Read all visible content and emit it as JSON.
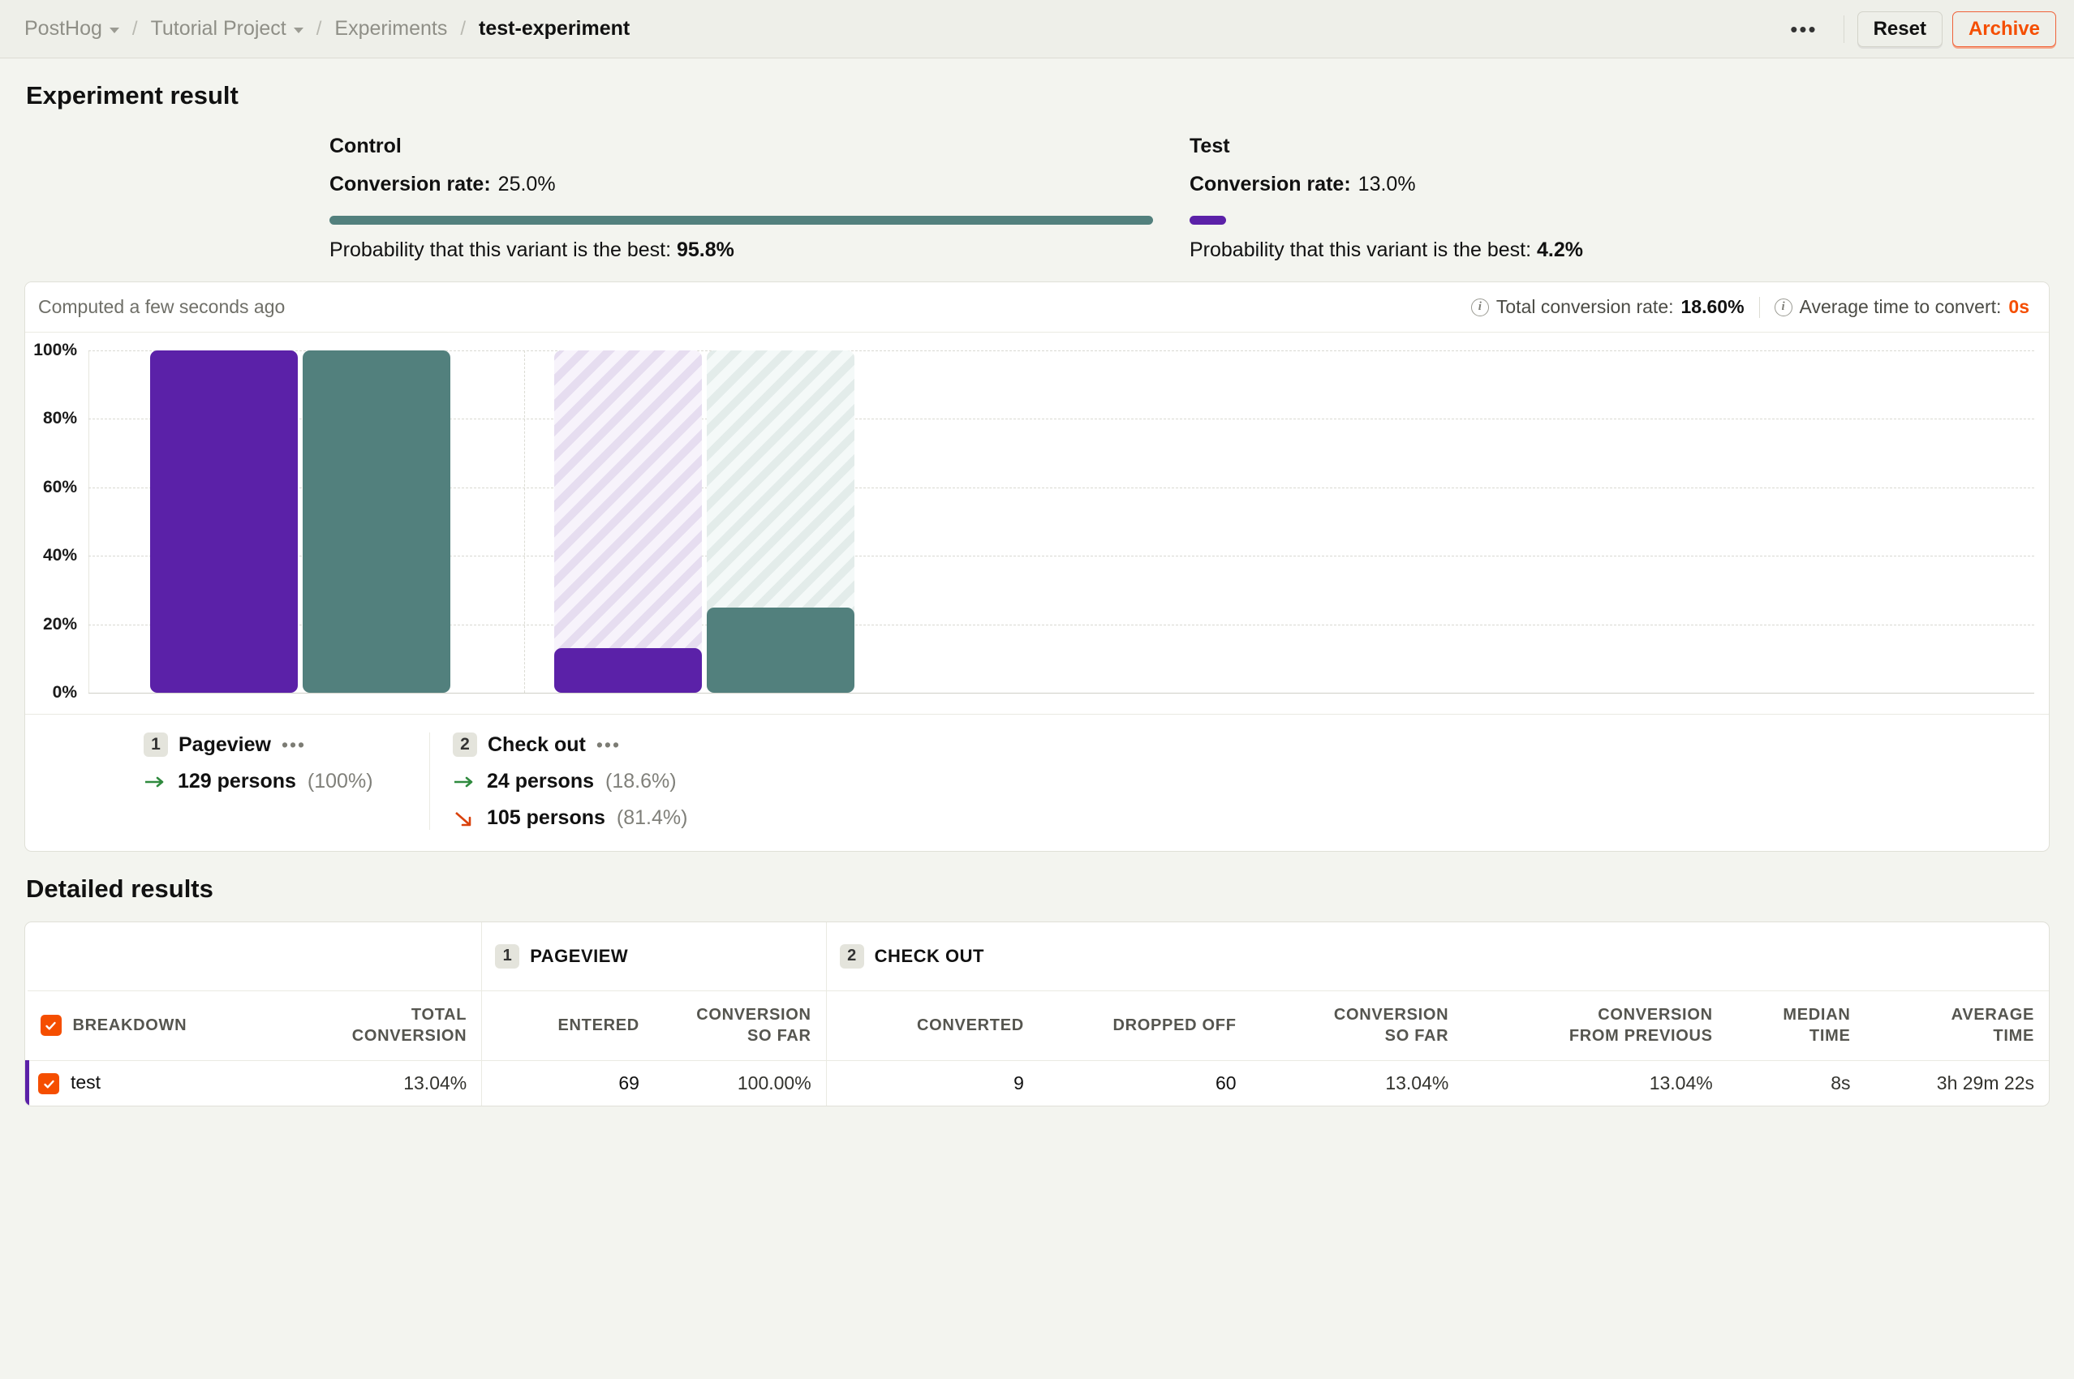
{
  "breadcrumbs": [
    {
      "label": "PostHog",
      "has_chevron": true,
      "active": false
    },
    {
      "label": "Tutorial Project",
      "has_chevron": true,
      "active": false
    },
    {
      "label": "Experiments",
      "has_chevron": false,
      "active": false
    },
    {
      "label": "test-experiment",
      "has_chevron": false,
      "active": true
    }
  ],
  "topbar": {
    "more_label": "•••",
    "reset_label": "Reset",
    "archive_label": "Archive"
  },
  "experiment_result": {
    "title": "Experiment result",
    "variants": [
      {
        "name": "Control",
        "conversion_label": "Conversion rate:",
        "conversion_rate": "25.0%",
        "probability_label": "Probability that this variant is the best:",
        "probability": "95.8%",
        "probability_value": 95.8,
        "color": "#52807d"
      },
      {
        "name": "Test",
        "conversion_label": "Conversion rate:",
        "conversion_rate": "13.0%",
        "probability_label": "Probability that this variant is the best:",
        "probability": "4.2%",
        "probability_value": 4.2,
        "color": "#5b21a8"
      }
    ]
  },
  "funnel_card": {
    "computed_text": "Computed a few seconds ago",
    "total_conversion_label": "Total conversion rate:",
    "total_conversion_value": "18.60%",
    "avg_time_label": "Average time to convert:",
    "avg_time_value": "0s"
  },
  "chart_data": {
    "type": "bar",
    "title": "",
    "xlabel": "",
    "ylabel": "",
    "ylim": [
      0,
      100
    ],
    "ytick_labels": [
      "0%",
      "20%",
      "40%",
      "60%",
      "80%",
      "100%"
    ],
    "yticks": [
      0,
      20,
      40,
      60,
      80,
      100
    ],
    "grid": true,
    "legend_position": "below",
    "categories": [
      "Pageview",
      "Check out"
    ],
    "series": [
      {
        "name": "test",
        "color": "#5b21a8",
        "values": [
          100,
          13.04
        ]
      },
      {
        "name": "control",
        "color": "#52807d",
        "values": [
          100,
          25.0
        ]
      }
    ]
  },
  "funnel_steps": [
    {
      "number": "1",
      "name": "Pageview",
      "dots": "•••",
      "converted_count": "129 persons",
      "converted_pct": "(100%)",
      "dropped_count": null,
      "dropped_pct": null
    },
    {
      "number": "2",
      "name": "Check out",
      "dots": "•••",
      "converted_count": "24 persons",
      "converted_pct": "(18.6%)",
      "dropped_count": "105 persons",
      "dropped_pct": "(81.4%)"
    }
  ],
  "detailed_results": {
    "title": "Detailed results",
    "group_headers": [
      {
        "number": null,
        "label": ""
      },
      {
        "number": "1",
        "label": "PAGEVIEW"
      },
      {
        "number": "2",
        "label": "CHECK OUT"
      }
    ],
    "columns": [
      "BREAKDOWN",
      "TOTAL CONVERSION",
      "ENTERED",
      "CONVERSION SO FAR",
      "CONVERTED",
      "DROPPED OFF",
      "CONVERSION SO FAR",
      "CONVERSION FROM PREVIOUS",
      "MEDIAN TIME",
      "AVERAGE TIME"
    ],
    "columns_lines": [
      [
        "BREAKDOWN"
      ],
      [
        "TOTAL",
        "CONVERSION"
      ],
      [
        "ENTERED"
      ],
      [
        "CONVERSION",
        "SO FAR"
      ],
      [
        "CONVERTED"
      ],
      [
        "DROPPED OFF"
      ],
      [
        "CONVERSION",
        "SO FAR"
      ],
      [
        "CONVERSION",
        "FROM PREVIOUS"
      ],
      [
        "MEDIAN",
        "TIME"
      ],
      [
        "AVERAGE",
        "TIME"
      ]
    ],
    "rows": [
      {
        "name": "test",
        "checked": true,
        "accent": "#5b21a8",
        "total_conversion": "13.04%",
        "entered": "69",
        "conversion_so_far_1": "100.00%",
        "converted": "9",
        "dropped_off": "60",
        "conversion_so_far_2": "13.04%",
        "conversion_from_previous": "13.04%",
        "median_time": "8s",
        "average_time": "3h 29m 22s"
      }
    ]
  },
  "colors": {
    "purple": "#5b21a8",
    "teal": "#52807d",
    "orange": "#f54e00",
    "page_bg": "#f3f4ef"
  }
}
